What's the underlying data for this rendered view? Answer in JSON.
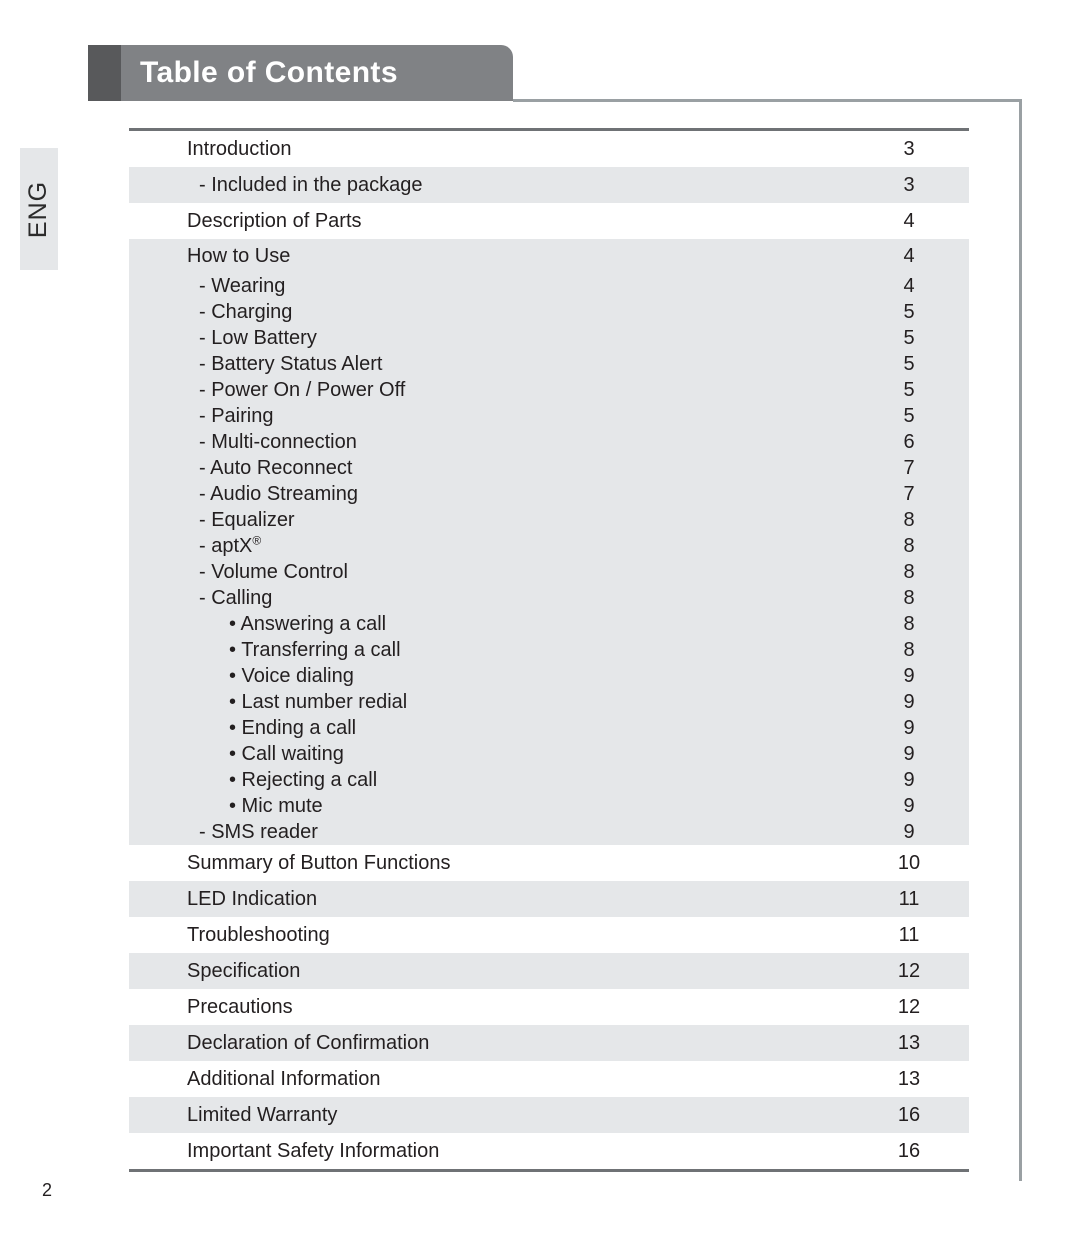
{
  "page": {
    "title": "Table of Contents",
    "folio": "2",
    "language_tab": "ENG",
    "colors": {
      "banner": "#808285",
      "banner_accent": "#58595B",
      "row_shaded": "#E5E7E9",
      "rule": "#6F7275",
      "frame_rule": "#9AA0A3",
      "text": "#231F20"
    }
  },
  "toc": {
    "entries": [
      {
        "label": "Introduction",
        "page": "3",
        "level": 0,
        "shaded": false,
        "spacing": "pad-both"
      },
      {
        "label": "- Included in the package",
        "page": "3",
        "level": 1,
        "shaded": true,
        "spacing": "pad-both"
      },
      {
        "label": "Description of Parts",
        "page": "4",
        "level": 0,
        "shaded": false,
        "spacing": "pad-both"
      },
      {
        "label": "How to Use",
        "page": "4",
        "level": 0,
        "shaded": true,
        "spacing": "pad-top"
      },
      {
        "label": "- Wearing",
        "page": "4",
        "level": 1,
        "shaded": true,
        "spacing": "tight"
      },
      {
        "label": "- Charging",
        "page": "5",
        "level": 1,
        "shaded": true,
        "spacing": "tight"
      },
      {
        "label": "- Low Battery",
        "page": "5",
        "level": 1,
        "shaded": true,
        "spacing": "tight"
      },
      {
        "label": "- Battery Status Alert",
        "page": "5",
        "level": 1,
        "shaded": true,
        "spacing": "tight"
      },
      {
        "label": "- Power On / Power Off",
        "page": "5",
        "level": 1,
        "shaded": true,
        "spacing": "tight"
      },
      {
        "label": "- Pairing",
        "page": "5",
        "level": 1,
        "shaded": true,
        "spacing": "tight"
      },
      {
        "label": "- Multi-connection",
        "page": "6",
        "level": 1,
        "shaded": true,
        "spacing": "tight"
      },
      {
        "label": "- Auto Reconnect",
        "page": "7",
        "level": 1,
        "shaded": true,
        "spacing": "tight"
      },
      {
        "label": "- Audio Streaming",
        "page": "7",
        "level": 1,
        "shaded": true,
        "spacing": "tight"
      },
      {
        "label": "- Equalizer",
        "page": "8",
        "level": 1,
        "shaded": true,
        "spacing": "tight"
      },
      {
        "label": "- aptX®",
        "page": "8",
        "level": 1,
        "shaded": true,
        "spacing": "tight",
        "has_superscript_reg": true,
        "base_label": "- aptX"
      },
      {
        "label": "- Volume Control",
        "page": "8",
        "level": 1,
        "shaded": true,
        "spacing": "tight"
      },
      {
        "label": "- Calling",
        "page": "8",
        "level": 1,
        "shaded": true,
        "spacing": "tight"
      },
      {
        "label": "• Answering a call",
        "page": "8",
        "level": 2,
        "shaded": true,
        "spacing": "tight"
      },
      {
        "label": "• Transferring a call",
        "page": "8",
        "level": 2,
        "shaded": true,
        "spacing": "tight"
      },
      {
        "label": "• Voice dialing",
        "page": "9",
        "level": 2,
        "shaded": true,
        "spacing": "tight"
      },
      {
        "label": "• Last number redial",
        "page": "9",
        "level": 2,
        "shaded": true,
        "spacing": "tight"
      },
      {
        "label": "• Ending a call",
        "page": "9",
        "level": 2,
        "shaded": true,
        "spacing": "tight"
      },
      {
        "label": "• Call waiting",
        "page": "9",
        "level": 2,
        "shaded": true,
        "spacing": "tight"
      },
      {
        "label": "• Rejecting a call",
        "page": "9",
        "level": 2,
        "shaded": true,
        "spacing": "tight"
      },
      {
        "label": "• Mic mute",
        "page": "9",
        "level": 2,
        "shaded": true,
        "spacing": "tight"
      },
      {
        "label": "- SMS reader",
        "page": "9",
        "level": 1,
        "shaded": true,
        "spacing": "tight"
      },
      {
        "label": "Summary of Button Functions",
        "page": "10",
        "level": 0,
        "shaded": false,
        "spacing": "pad-both"
      },
      {
        "label": "LED Indication",
        "page": "11",
        "level": 0,
        "shaded": true,
        "spacing": "pad-both"
      },
      {
        "label": "Troubleshooting",
        "page": "11",
        "level": 0,
        "shaded": false,
        "spacing": "pad-both"
      },
      {
        "label": "Specification",
        "page": "12",
        "level": 0,
        "shaded": true,
        "spacing": "pad-both"
      },
      {
        "label": "Precautions",
        "page": "12",
        "level": 0,
        "shaded": false,
        "spacing": "pad-both"
      },
      {
        "label": "Declaration of Confirmation",
        "page": "13",
        "level": 0,
        "shaded": true,
        "spacing": "pad-both"
      },
      {
        "label": "Additional Information",
        "page": "13",
        "level": 0,
        "shaded": false,
        "spacing": "pad-both"
      },
      {
        "label": "Limited Warranty",
        "page": "16",
        "level": 0,
        "shaded": true,
        "spacing": "pad-both"
      },
      {
        "label": "Important Safety Information",
        "page": "16",
        "level": 0,
        "shaded": false,
        "spacing": "pad-both"
      }
    ]
  }
}
